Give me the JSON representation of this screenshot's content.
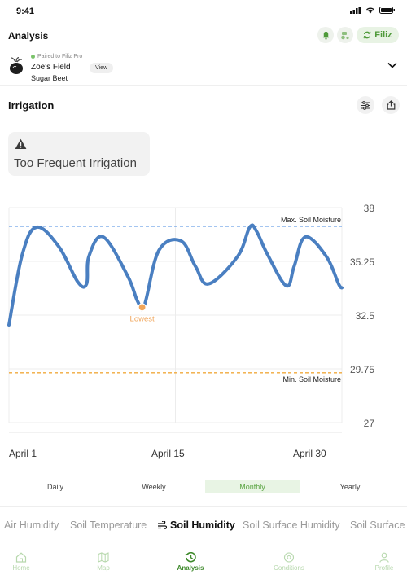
{
  "status_bar": {
    "time": "9:41"
  },
  "header": {
    "title": "Analysis",
    "filiz_label": "Filiz"
  },
  "field": {
    "paired_text": "Paired to Filiz Pro",
    "name": "Zoe's Field",
    "view_label": "View",
    "crop": "Sugar Beet"
  },
  "section": {
    "title": "Irrigation"
  },
  "alert": {
    "text": "Too Frequent Irrigation"
  },
  "chart_data": {
    "type": "line",
    "title": "",
    "x_ticks": [
      "April 1",
      "April 15",
      "April 30"
    ],
    "y_ticks": [
      38,
      35.25,
      32.5,
      29.75,
      27
    ],
    "ylim": [
      27,
      38
    ],
    "grid": true,
    "series": [
      {
        "color": "#4a7fc1",
        "x": [
          0,
          1.2,
          2.5,
          4.5,
          6.2,
          7.0,
          7.2,
          8.5,
          10.7,
          11.6,
          12.2,
          13.5,
          15.5,
          16.8,
          18.0,
          20.6,
          21.7,
          22.3,
          23.3,
          25.0,
          25.7,
          26.7,
          28.6,
          29.7,
          30.0
        ],
        "y": [
          32.0,
          35.6,
          37.0,
          36.0,
          34.2,
          34.1,
          35.5,
          36.5,
          34.5,
          33.2,
          33.0,
          35.8,
          36.3,
          35.0,
          34.1,
          35.5,
          37.0,
          36.8,
          35.6,
          34.0,
          35.0,
          36.5,
          35.5,
          34.1,
          33.9
        ]
      }
    ],
    "reference_lines": [
      {
        "label": "Max. Soil Moisture",
        "value": 37.05,
        "color": "#4a8be0"
      },
      {
        "label": "Min. Soil Moisture",
        "value": 29.55,
        "color": "#f0a93d"
      }
    ],
    "annotations": [
      {
        "label": "Lowest",
        "x": 12.0,
        "y": 32.9,
        "color": "#f0a55a"
      }
    ]
  },
  "periods": [
    {
      "label": "Daily",
      "active": false
    },
    {
      "label": "Weekly",
      "active": false
    },
    {
      "label": "Monthly",
      "active": true
    },
    {
      "label": "Yearly",
      "active": false
    }
  ],
  "metrics": [
    {
      "label": "Air Humidity",
      "active": false
    },
    {
      "label": "Soil Temperature",
      "active": false
    },
    {
      "label": "Soil Humidity",
      "active": true
    },
    {
      "label": "Soil Surface Humidity",
      "active": false
    },
    {
      "label": "Soil Surface",
      "active": false
    }
  ],
  "tabbar": [
    {
      "label": "Home",
      "icon": "home-icon",
      "active": false
    },
    {
      "label": "Map",
      "icon": "map-icon",
      "active": false
    },
    {
      "label": "Analysis",
      "icon": "history-icon",
      "active": true
    },
    {
      "label": "Conditions",
      "icon": "conditions-icon",
      "active": false
    },
    {
      "label": "Profile",
      "icon": "profile-icon",
      "active": false
    }
  ],
  "colors": {
    "accent": "#4f9a3a",
    "accent_light": "#e8f4e4",
    "line": "#4a7fc1"
  }
}
